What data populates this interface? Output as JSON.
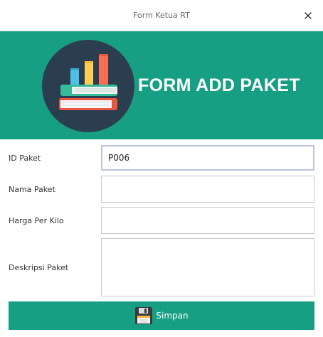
{
  "window": {
    "title": "Form Ketua RT"
  },
  "header": {
    "title": "FORM ADD PAKET"
  },
  "form": {
    "id_paket": {
      "label": "ID Paket",
      "value": "P006"
    },
    "nama_paket": {
      "label": "Nama Paket",
      "value": ""
    },
    "harga_per_kilo": {
      "label": "Harga Per Kilo",
      "value": ""
    },
    "deskripsi_paket": {
      "label": "Deskripsi Paket",
      "value": ""
    }
  },
  "actions": {
    "save_label": "Simpan"
  },
  "colors": {
    "accent": "#179f84",
    "logo_circle": "#2b3e50"
  },
  "icons": {
    "close": "close-icon",
    "logo": "books-chart-logo",
    "save": "floppy-disk-icon"
  }
}
